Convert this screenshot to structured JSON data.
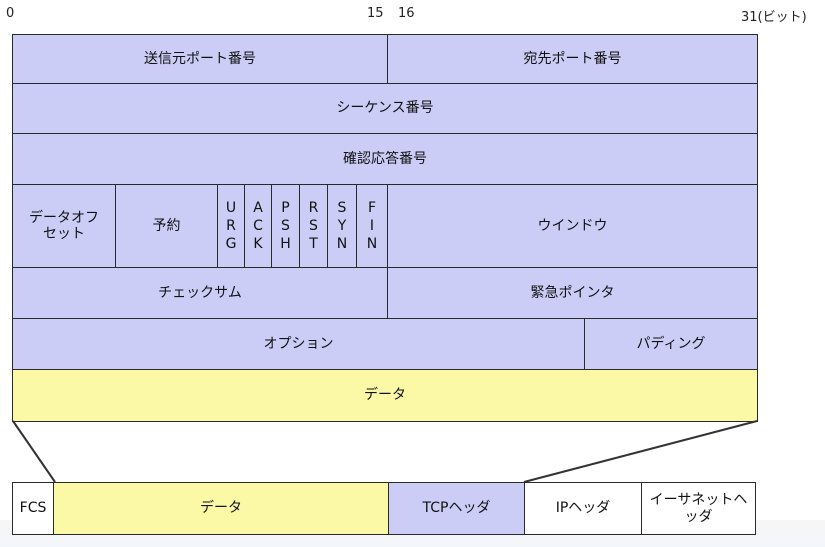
{
  "bit_labels": {
    "b0": "0",
    "b15": "15",
    "b16": "16",
    "b31": "31(ビット)"
  },
  "header": {
    "src_port": "送信元ポート番号",
    "dst_port": "宛先ポート番号",
    "seq": "シーケンス番号",
    "ack": "確認応答番号",
    "data_offset_1": "データオフ",
    "data_offset_2": "セット",
    "reserved": "予約",
    "flags": [
      [
        "U",
        "R",
        "G"
      ],
      [
        "A",
        "C",
        "K"
      ],
      [
        "P",
        "S",
        "H"
      ],
      [
        "R",
        "S",
        "T"
      ],
      [
        "S",
        "Y",
        "N"
      ],
      [
        "F",
        "I",
        "N"
      ]
    ],
    "window": "ウインドウ",
    "checksum": "チェックサム",
    "urgent": "緊急ポインタ",
    "options": "オプション",
    "padding": "パディング",
    "data": "データ"
  },
  "frame": {
    "fcs": "FCS",
    "data": "データ",
    "tcp_header": "TCPヘッダ",
    "ip_header": "IPヘッダ",
    "eth_1": "イーサネットヘ",
    "eth_2": "ッダ"
  },
  "colors": {
    "blue": "#cccdf7",
    "yellow": "#fbf9a6",
    "border": "#2a2a2a"
  }
}
